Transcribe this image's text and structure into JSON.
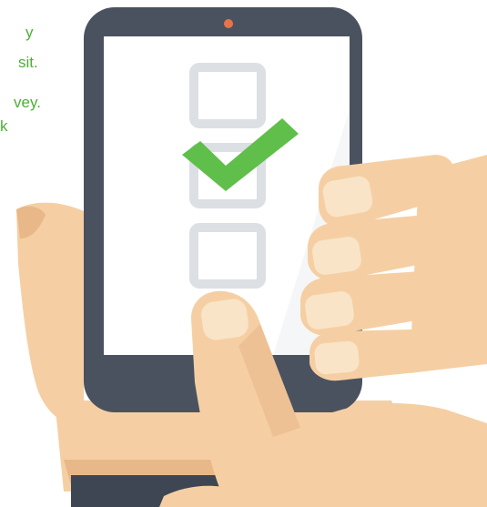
{
  "text_fragments": [
    "y",
    "sit.",
    "vey.",
    "k"
  ],
  "colors": {
    "accent_green": "#5fbf4a",
    "text_green": "#4caf35",
    "phone_body": "#4a5260",
    "phone_screen": "#ffffff",
    "camera_dot": "#e8734a",
    "checkbox_gray": "#dcdfe3",
    "skin": "#f5cfa3",
    "skin_shadow": "#e8b888",
    "nail": "#f9e4c8",
    "sleeve": "#3e4654"
  },
  "checklist": {
    "checkboxes": [
      {
        "checked": false
      },
      {
        "checked": true
      },
      {
        "checked": false
      }
    ]
  },
  "icons": {
    "checkmark": "checkmark-icon",
    "camera": "camera-dot-icon"
  }
}
